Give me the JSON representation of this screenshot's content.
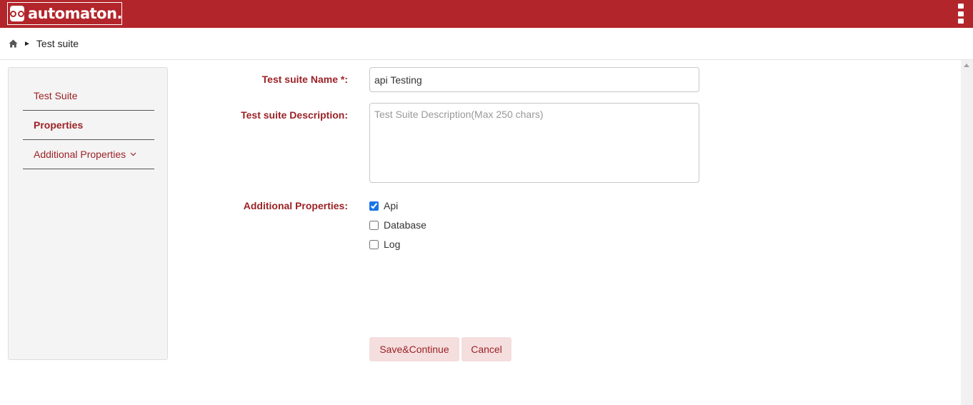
{
  "app": {
    "logo_text": "automaton."
  },
  "breadcrumb": {
    "separator": "►",
    "current": "Test suite"
  },
  "sidebar": {
    "items": [
      {
        "label": "Test Suite"
      },
      {
        "label": "Properties"
      },
      {
        "label": "Additional Properties"
      }
    ]
  },
  "form": {
    "name_label": "Test suite Name *:",
    "name_value": "api Testing",
    "description_label": "Test suite Description:",
    "description_placeholder": "Test Suite Description(Max 250 chars)",
    "additional_label": "Additional Properties:",
    "options": [
      {
        "label": "Api",
        "checked": true
      },
      {
        "label": "Database",
        "checked": false
      },
      {
        "label": "Log",
        "checked": false
      }
    ]
  },
  "buttons": {
    "save": "Save&Continue",
    "cancel": "Cancel"
  },
  "colors": {
    "brand": "#b2252a",
    "accent_text": "#9b2226",
    "button_bg": "#f5dede"
  },
  "icons": {
    "home": "home-icon",
    "menu": "kebab-menu-icon",
    "chevron": "chevron-down-icon"
  }
}
